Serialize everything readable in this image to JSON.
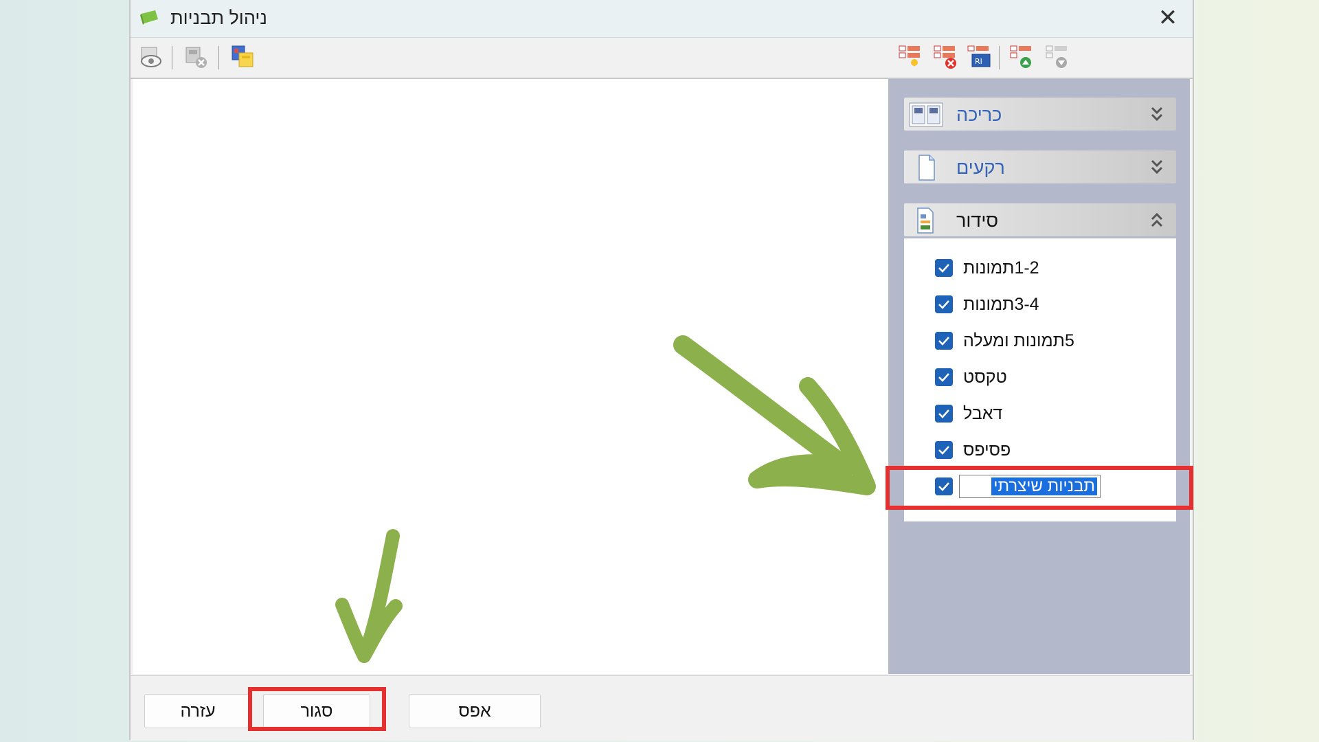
{
  "window": {
    "title": "ניהול תבניות",
    "close_icon": "close-icon"
  },
  "toolbar": {
    "left_icons": [
      "preview-icon",
      "delete-template-icon",
      "copy-template-icon"
    ],
    "right_icons": [
      "add-template-icon",
      "remove-template-icon",
      "rename-template-icon",
      "move-up-icon",
      "move-down-icon"
    ]
  },
  "sidebar": {
    "groups": [
      {
        "label": "כריכה",
        "icon": "cover-layout-icon",
        "state": "collapsed"
      },
      {
        "label": "רקעים",
        "icon": "page-background-icon",
        "state": "collapsed"
      },
      {
        "label": "סידור",
        "icon": "arrangement-icon",
        "state": "expanded"
      }
    ],
    "items": [
      {
        "label": "1-2תמונות",
        "checked": true
      },
      {
        "label": "3-4תמונות",
        "checked": true
      },
      {
        "label": "5תמונות ומעלה",
        "checked": true
      },
      {
        "label": "טקסט",
        "checked": true
      },
      {
        "label": "דאבל",
        "checked": true
      },
      {
        "label": "פסיפס",
        "checked": true
      },
      {
        "label": "תבניות שיצרתי",
        "checked": true,
        "editing": true
      }
    ]
  },
  "footer": {
    "help_label": "עזרה",
    "close_label": "סגור",
    "reset_label": "אפס"
  },
  "colors": {
    "highlight_red": "#e62f2f",
    "annotation_green": "#8bb04c",
    "checkbox_blue": "#1e63b8"
  }
}
